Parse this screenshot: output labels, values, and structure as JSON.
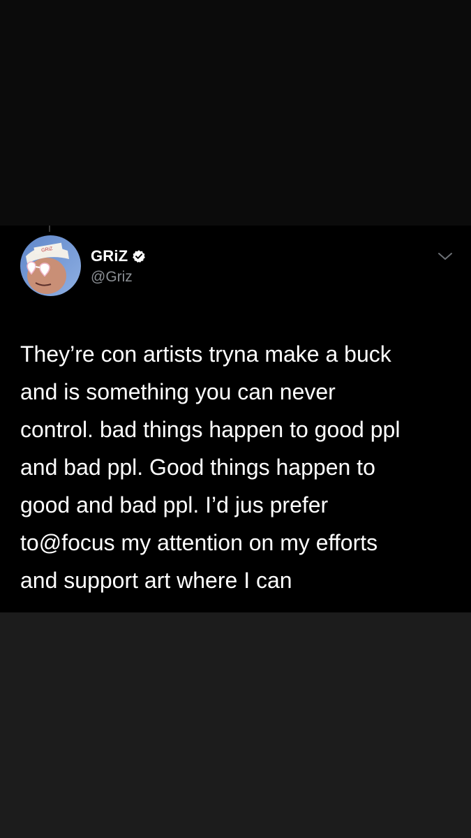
{
  "author": {
    "display_name": "GRiZ",
    "handle": "@Griz",
    "verified": true,
    "avatar_icon": "avatar-photo"
  },
  "tweet": {
    "lines": [
      "They’re con artists tryna make a buck",
      "and is something you can never",
      "control. bad things happen to good ppl",
      "and bad ppl. Good things happen to",
      "good and bad ppl. I’d jus prefer",
      "to@focus my attention on my efforts",
      "and support art where I can"
    ]
  },
  "icons": {
    "verified": "verified-badge-icon",
    "menu": "chevron-down-icon"
  },
  "colors": {
    "card_background": "#000000",
    "page_background": "#1c1c1c",
    "top_background": "#0b0b0b",
    "text_primary": "#ffffff",
    "text_secondary": "#8b8f94"
  }
}
